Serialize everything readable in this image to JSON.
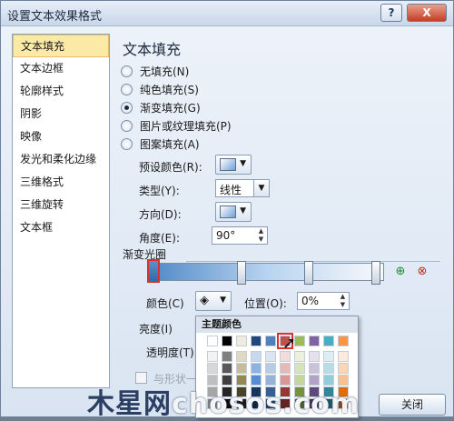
{
  "window": {
    "title": "设置文本效果格式",
    "help_glyph": "?",
    "close_glyph": "X"
  },
  "nav": {
    "items": [
      {
        "label": "文本填充",
        "active": true
      },
      {
        "label": "文本边框"
      },
      {
        "label": "轮廓样式"
      },
      {
        "label": "阴影"
      },
      {
        "label": "映像"
      },
      {
        "label": "发光和柔化边缘"
      },
      {
        "label": "三维格式"
      },
      {
        "label": "三维旋转"
      },
      {
        "label": "文本框"
      }
    ]
  },
  "panel": {
    "heading": "文本填充",
    "fill_options": [
      {
        "label": "无填充(N)",
        "selected": false
      },
      {
        "label": "纯色填充(S)",
        "selected": false
      },
      {
        "label": "渐变填充(G)",
        "selected": true
      },
      {
        "label": "图片或纹理填充(P)",
        "selected": false
      },
      {
        "label": "图案填充(A)",
        "selected": false
      }
    ],
    "preset_label": "预设颜色(R):",
    "type_label": "类型(Y):",
    "type_value": "线性",
    "direction_label": "方向(D):",
    "angle_label": "角度(E):",
    "angle_value": "90°",
    "gradient_stops_label": "渐变光圈",
    "color_label": "颜色(C)",
    "position_label": "位置(O):",
    "position_value": "0%",
    "brightness_label": "亮度(I)",
    "transparency_label": "透明度(T)",
    "rotate_with_shape_label": "与形状一"
  },
  "color_popup": {
    "title": "主题颜色",
    "head_colors": [
      "#ffffff",
      "#000000",
      "#eeece1",
      "#1f497d",
      "#4f81bd",
      "#c0504d",
      "#9bbb59",
      "#8064a2",
      "#4bacc6",
      "#f79646"
    ],
    "columns": [
      [
        "#f2f2f2",
        "#d8d8d8",
        "#bfbfbf",
        "#a5a5a5",
        "#7f7f7f"
      ],
      [
        "#7f7f7f",
        "#595959",
        "#3f3f3f",
        "#262626",
        "#0c0c0c"
      ],
      [
        "#ddd9c3",
        "#c4bd97",
        "#938953",
        "#494429",
        "#1d1b10"
      ],
      [
        "#c6d9f0",
        "#8db3e2",
        "#548dd4",
        "#17365d",
        "#0f243e"
      ],
      [
        "#dbe5f1",
        "#b8cce4",
        "#95b3d7",
        "#366092",
        "#244061"
      ],
      [
        "#f2dcdb",
        "#e5b9b7",
        "#d99694",
        "#953734",
        "#632423"
      ],
      [
        "#ebf1dd",
        "#d7e3bc",
        "#c3d69b",
        "#76923c",
        "#4f6128"
      ],
      [
        "#e5e0ec",
        "#ccc1d9",
        "#b2a2c7",
        "#5f497a",
        "#3f3151"
      ],
      [
        "#dbeef3",
        "#b7dde8",
        "#92cddc",
        "#31859b",
        "#205867"
      ],
      [
        "#fdeada",
        "#fbd5b5",
        "#fac08f",
        "#e36c09",
        "#974806"
      ]
    ],
    "selected_index": 5
  },
  "ok_button_partial": "关闭",
  "watermark": {
    "part1": "木星网",
    "part2": "chosos.com"
  }
}
